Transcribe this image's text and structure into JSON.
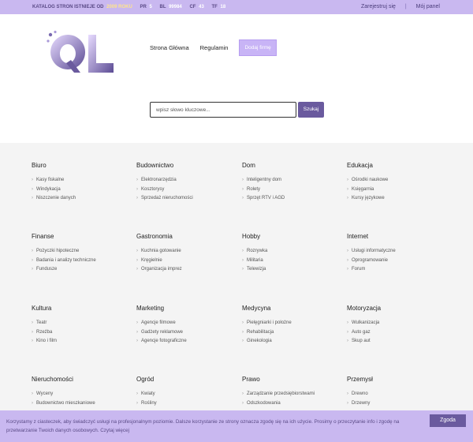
{
  "topbar": {
    "catalog_label": "KATALOG STRON ISTNIEJE OD",
    "catalog_year": "2009 ROKU",
    "pr_label": "PR",
    "pr_value": "5",
    "bl_label": "BL",
    "bl_value": "99984",
    "cf_label": "CF",
    "cf_value": "43",
    "tf_label": "TF",
    "tf_value": "18",
    "register": "Zarejestruj się",
    "separator": "|",
    "panel": "Mój panel"
  },
  "logo": {
    "text": "QL"
  },
  "nav": {
    "home": "Strona Główna",
    "rules": "Regulamin",
    "add_firm": "Dodaj firmę"
  },
  "search": {
    "placeholder": "wpisz słowo kluczowe...",
    "button": "Szukaj"
  },
  "categories": [
    {
      "title": "Biuro",
      "items": [
        "Kasy fiskalne",
        "Windykacja",
        "Niszczenie danych"
      ]
    },
    {
      "title": "Budownictwo",
      "items": [
        "Elektronarzędzia",
        "Kosztorysy",
        "Sprzedaż nieruchomości"
      ]
    },
    {
      "title": "Dom",
      "items": [
        "Inteligentny dom",
        "Rolety",
        "Sprzęt RTV i AGD"
      ]
    },
    {
      "title": "Edukacja",
      "items": [
        "Ośrodki naukowe",
        "Księgarnia",
        "Kursy językowe"
      ]
    },
    {
      "title": "Finanse",
      "items": [
        "Pożyczki hipoteczne",
        "Badania i analizy techniczne",
        "Fundusze"
      ]
    },
    {
      "title": "Gastronomia",
      "items": [
        "Kuchnia gotowanie",
        "Kręgielnie",
        "Organizacja imprez"
      ]
    },
    {
      "title": "Hobby",
      "items": [
        "Rozrywka",
        "Militaria",
        "Telewizja"
      ]
    },
    {
      "title": "Internet",
      "items": [
        "Usługi informatyczne",
        "Oprogramowanie",
        "Forum"
      ]
    },
    {
      "title": "Kultura",
      "items": [
        "Teatr",
        "Rzeźba",
        "Kino i film"
      ]
    },
    {
      "title": "Marketing",
      "items": [
        "Agencje filmowe",
        "Gadżety reklamowe",
        "Agencje fotograficzne"
      ]
    },
    {
      "title": "Medycyna",
      "items": [
        "Pielęgniarki i położne",
        "Rehabilitacja",
        "Ginekologia"
      ]
    },
    {
      "title": "Motoryzacja",
      "items": [
        "Wulkanizacja",
        "Auto gaz",
        "Skup aut"
      ]
    },
    {
      "title": "Nieruchomości",
      "items": [
        "Wyceny",
        "Budownictwo mieszkaniowe"
      ]
    },
    {
      "title": "Ogród",
      "items": [
        "Kwiaty",
        "Rośliny"
      ]
    },
    {
      "title": "Prawo",
      "items": [
        "Zarządzanie przedsiębiorstwami",
        "Odszkodowania"
      ]
    },
    {
      "title": "Przemysł",
      "items": [
        "Drewno",
        "Drzewny"
      ]
    }
  ],
  "cookie": {
    "text": "Korzystamy z ciasteczek, aby świadczyć usługi na profesjonalnym poziomie. Dalsze korzystanie ze strony oznacza zgodę się na ich użycie. Prosimy o przeczytanie info i zgodę na przetwarzanie Twoich danych osobowych. Czytaj więcej",
    "accept": "Zgoda"
  },
  "colors": {
    "accent": "#c9b8f0",
    "button": "#6a5a9e"
  }
}
